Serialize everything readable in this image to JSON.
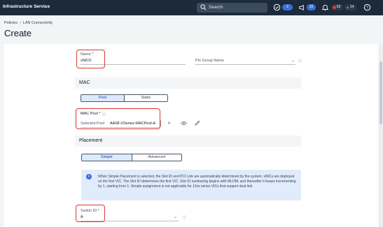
{
  "topbar": {
    "app_title": "Infrastructure Service",
    "search_label": "Search",
    "badges": {
      "tasks": "2",
      "announcements": "15",
      "alarms_critical": "53",
      "alarms_warning": "14"
    },
    "colors": {
      "background": "#1c2a3a",
      "critical": "#e03b2f",
      "warning": "#e0a21b",
      "info": "#3b6fd8"
    }
  },
  "breadcrumb": {
    "items": [
      "Policies",
      "LAN Connectivity"
    ]
  },
  "page": {
    "title": "Create"
  },
  "general": {
    "name_label": "Name *",
    "name_value": "vNIC0",
    "pin_group_placeholder": "Pin Group Name"
  },
  "mac": {
    "section_title": "MAC",
    "toggle": {
      "options": [
        "Pool",
        "Static"
      ],
      "selected": "Pool"
    },
    "pool_label": "MAC Pool *",
    "selected_pool_label": "Selected Pool",
    "selected_pool_value": "AA08-XSeries-MACPool-A"
  },
  "placement": {
    "section_title": "Placement",
    "toggle": {
      "options": [
        "Simple",
        "Advanced"
      ],
      "selected": "Simple"
    },
    "info_text": "When Simple Placement is selected, the Slot ID and PCI Link are automatically determined by the system. vNICs are deployed on the first VIC. The Slot ID determines the first VIC. Slot ID numbering begins with MLOM, and thereafter it keeps incrementing by 1, starting from 1. Simple assignment is not applicable for 13xx series VICs that support dual link.",
    "switch_id_label": "Switch ID *",
    "switch_id_value": "A"
  }
}
